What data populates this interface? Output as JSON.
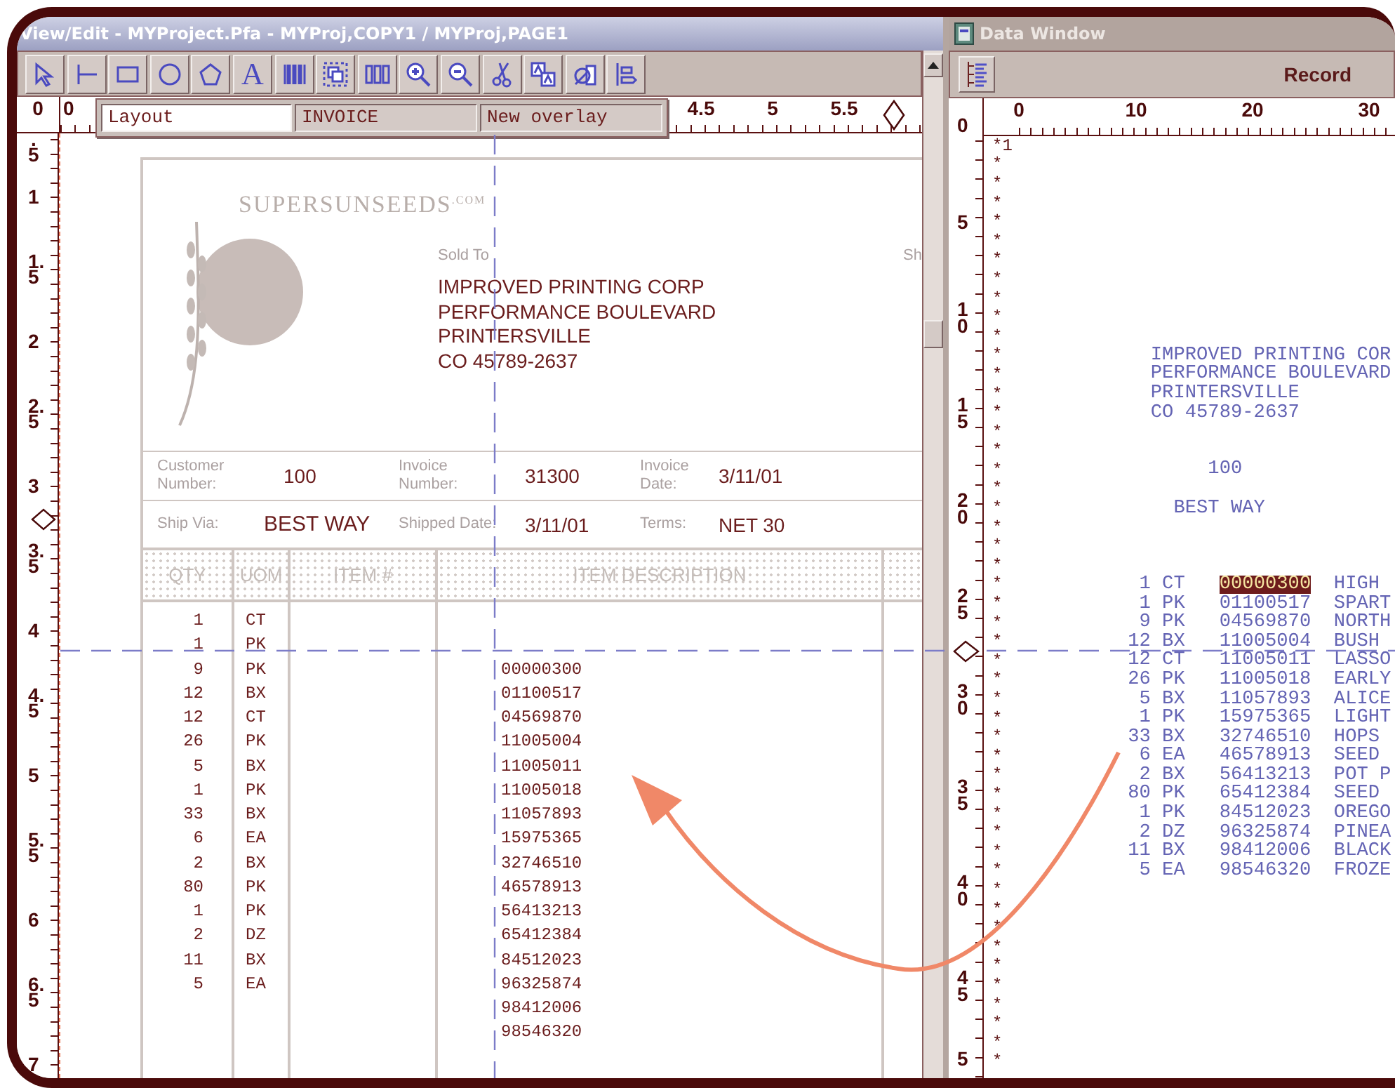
{
  "edit_window": {
    "title": "View/Edit - MYProject.Pfa - MYProj,COPY1 / MYProj,PAGE1",
    "tools": [
      {
        "kind": "pointer"
      },
      {
        "kind": "line"
      },
      {
        "kind": "rectangle"
      },
      {
        "kind": "ellipse"
      },
      {
        "kind": "polygon"
      },
      {
        "kind": "text",
        "glyph": "A"
      },
      {
        "kind": "barcode"
      },
      {
        "kind": "group"
      },
      {
        "kind": "columns"
      },
      {
        "kind": "zoom_in"
      },
      {
        "kind": "zoom_out"
      },
      {
        "kind": "scissors"
      },
      {
        "kind": "font"
      },
      {
        "kind": "stamp"
      },
      {
        "kind": "flow"
      }
    ],
    "overlay_bar": [
      {
        "value": "Layout",
        "selected": true
      },
      {
        "value": "INVOICE",
        "selected": false
      },
      {
        "value": "New overlay",
        "selected": false
      }
    ],
    "ruler_corner": "0",
    "top_ruler": [
      "0",
      "4.5",
      "5",
      "5.5"
    ],
    "side_ruler": [
      ".5",
      "1",
      "1.5",
      "2",
      "2.5",
      "3",
      "3.5",
      "4",
      "4.5",
      "5",
      "5.5",
      "6",
      "6.5",
      "7"
    ],
    "document": {
      "logo_text": "SUPERSUNSEEDS$^{.COM}$",
      "sold_to_label": "Sold To",
      "ship_to_label": "Sh",
      "sold_to": [
        "IMPROVED PRINTING CORP",
        "PERFORMANCE BOULEVARD",
        "PRINTERSVILLE",
        "CO  45789-2637"
      ],
      "fields": [
        {
          "label": "Customer Number:",
          "value": "100"
        },
        {
          "label": "Invoice Number:",
          "value": "31300"
        },
        {
          "label": "Invoice Date:",
          "value": "3/11/01"
        }
      ],
      "ship_fields": [
        {
          "label": "Ship Via:",
          "value": "BEST WAY"
        },
        {
          "label": "Shipped Date:",
          "value": "3/11/01"
        },
        {
          "label": "Terms:",
          "value": "NET 30"
        }
      ],
      "columns": [
        "QTY",
        "UOM",
        "ITEM #",
        "ITEM DESCRIPTION"
      ],
      "lines": [
        {
          "qty": "1",
          "uom": "CT"
        },
        {
          "qty": "1",
          "uom": "PK"
        },
        {
          "qty": "9",
          "uom": "PK"
        },
        {
          "qty": "12",
          "uom": "BX"
        },
        {
          "qty": "12",
          "uom": "CT"
        },
        {
          "qty": "26",
          "uom": "PK"
        },
        {
          "qty": "5",
          "uom": "BX"
        },
        {
          "qty": "1",
          "uom": "PK"
        },
        {
          "qty": "33",
          "uom": "BX"
        },
        {
          "qty": "6",
          "uom": "EA"
        },
        {
          "qty": "2",
          "uom": "BX"
        },
        {
          "qty": "80",
          "uom": "PK"
        },
        {
          "qty": "1",
          "uom": "PK"
        },
        {
          "qty": "2",
          "uom": "DZ"
        },
        {
          "qty": "11",
          "uom": "BX"
        },
        {
          "qty": "5",
          "uom": "EA"
        }
      ],
      "item_numbers": [
        "00000300",
        "01100517",
        "04569870",
        "11005004",
        "11005011",
        "11005018",
        "11057893",
        "15975365",
        "32746510",
        "46578913",
        "56413213",
        "65412384",
        "84512023",
        "96325874",
        "98412006",
        "98546320"
      ]
    }
  },
  "data_window": {
    "title": "Data Window",
    "record_label": "Record",
    "top_ruler": [
      "0",
      "10",
      "20",
      "30"
    ],
    "side_ruler": [
      "0",
      "5",
      "10",
      "15",
      "20",
      "25",
      "30",
      "35",
      "40",
      "45",
      "5"
    ],
    "line_markers": [
      "*1",
      "*",
      "*",
      "*",
      "*",
      "*",
      "*",
      "*",
      "*",
      "*",
      "*",
      "*",
      "*",
      "*",
      "*",
      "*",
      "*",
      "*",
      "*",
      "*",
      "*",
      "*",
      "*",
      "*",
      "*",
      "*",
      "*",
      "*",
      "*",
      "*",
      "*",
      "*",
      "*",
      "*",
      "*",
      "*",
      "*",
      "*",
      "*",
      "*",
      "*",
      "*",
      "*",
      "*",
      "*",
      "*",
      "*",
      "*",
      "*"
    ],
    "address": [
      "IMPROVED PRINTING COR",
      "PERFORMANCE BOULEVARD",
      "PRINTERSVILLE",
      "CO  45789-2637"
    ],
    "customer_number": "100",
    "ship_via": "BEST WAY",
    "items": [
      {
        "qty": "1",
        "uom": "CT",
        "item": "00000300",
        "description": "HIGH",
        "selected": true
      },
      {
        "qty": "1",
        "uom": "PK",
        "item": "01100517",
        "description": "SPART",
        "selected": false
      },
      {
        "qty": "9",
        "uom": "PK",
        "item": "04569870",
        "description": "NORTH",
        "selected": false
      },
      {
        "qty": "12",
        "uom": "BX",
        "item": "11005004",
        "description": "BUSH",
        "selected": false
      },
      {
        "qty": "12",
        "uom": "CT",
        "item": "11005011",
        "description": "LASSO",
        "selected": false
      },
      {
        "qty": "26",
        "uom": "PK",
        "item": "11005018",
        "description": "EARLY",
        "selected": false
      },
      {
        "qty": "5",
        "uom": "BX",
        "item": "11057893",
        "description": "ALICE",
        "selected": false
      },
      {
        "qty": "1",
        "uom": "PK",
        "item": "15975365",
        "description": "LIGHT",
        "selected": false
      },
      {
        "qty": "33",
        "uom": "BX",
        "item": "32746510",
        "description": "HOPS",
        "selected": false
      },
      {
        "qty": "6",
        "uom": "EA",
        "item": "46578913",
        "description": "SEED",
        "selected": false
      },
      {
        "qty": "2",
        "uom": "BX",
        "item": "56413213",
        "description": "POT P",
        "selected": false
      },
      {
        "qty": "80",
        "uom": "PK",
        "item": "65412384",
        "description": "SEED",
        "selected": false
      },
      {
        "qty": "1",
        "uom": "PK",
        "item": "84512023",
        "description": "OREGO",
        "selected": false
      },
      {
        "qty": "2",
        "uom": "DZ",
        "item": "96325874",
        "description": "PINEA",
        "selected": false
      },
      {
        "qty": "11",
        "uom": "BX",
        "item": "98412006",
        "description": "BLACK",
        "selected": false
      },
      {
        "qty": "5",
        "uom": "EA",
        "item": "98546320",
        "description": "FROZE",
        "selected": false
      }
    ]
  }
}
